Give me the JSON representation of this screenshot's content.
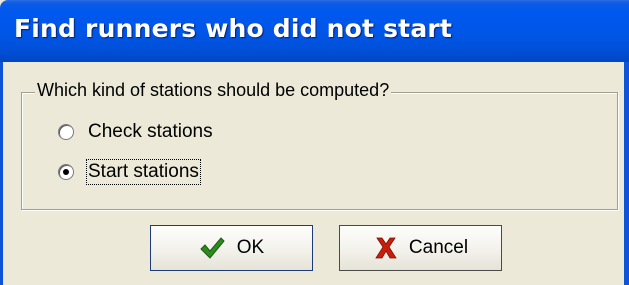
{
  "window": {
    "title": "Find runners who did not start"
  },
  "group": {
    "legend": "Which kind of stations should be computed?",
    "options": [
      {
        "label": "Check stations",
        "selected": false
      },
      {
        "label": "Start stations",
        "selected": true
      }
    ]
  },
  "buttons": {
    "ok_label": "OK",
    "ok_icon": "checkmark-icon",
    "cancel_label": "Cancel",
    "cancel_icon": "red-x-icon"
  },
  "colors": {
    "title_bar": "#0055E5",
    "face": "#ECE9D8",
    "check_green": "#2E8B1E",
    "cancel_red": "#C81E0A"
  }
}
